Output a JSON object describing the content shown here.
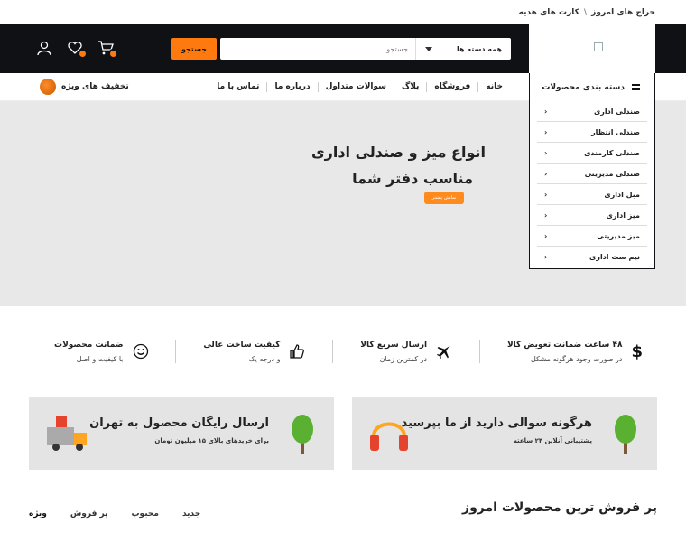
{
  "topbar": {
    "links": [
      "حراج های امروز",
      "کارت های هدیه"
    ],
    "separator": "\\"
  },
  "header": {
    "search_placeholder": "جستجو...",
    "category_select": "همه دسته ها",
    "search_button": "جستجو",
    "accent_color": "#ff7a0e"
  },
  "nav": {
    "categories_label": "دسته بندی محصولات",
    "links": [
      "خانه",
      "فروشگاه",
      "بلاگ",
      "سوالات متداول",
      "درباره ما",
      "تماس با ما"
    ],
    "deals_label": "تخفیف های ویژه"
  },
  "dropdown": {
    "items": [
      "صندلی اداری",
      "صندلی انتظار",
      "صندلی کارمندی",
      "صندلی مدیریتی",
      "مبل اداری",
      "میز اداری",
      "میز مدیریتی",
      "نیم ست اداری"
    ]
  },
  "hero": {
    "title_line1": "انواع میز و صندلی اداری",
    "title_line2": "مناسب دفتر شما",
    "button": "نمایش بیشتر"
  },
  "features": [
    {
      "title": "۴۸ ساعت ضمانت تعویض کالا",
      "sub": "در صورت وجود هرگونه مشکل",
      "icon": "dollar-icon"
    },
    {
      "title": "ارسال سریع کالا",
      "sub": "در کمترین زمان",
      "icon": "airplane-icon"
    },
    {
      "title": "کیفیت ساخت عالی",
      "sub": "و درجه یک",
      "icon": "thumbs-up-icon"
    },
    {
      "title": "ضمانت محصولات",
      "sub": "با کیفیت و اصل",
      "icon": "smile-icon"
    }
  ],
  "banners": [
    {
      "title": "هرگونه سوالی دارید از ما بپرسید",
      "sub": "پشتیبانی آنلاین ۲۴ ساعته"
    },
    {
      "title": "ارسال رایگان محصول به تهران",
      "sub": "برای خریدهای بالای ۱۵ میلیون تومان"
    }
  ],
  "bestsellers": {
    "title": "پر فروش ترین محصولات امروز",
    "tabs": [
      "ویژه",
      "پر فروش",
      "محبوب",
      "جدید"
    ]
  }
}
